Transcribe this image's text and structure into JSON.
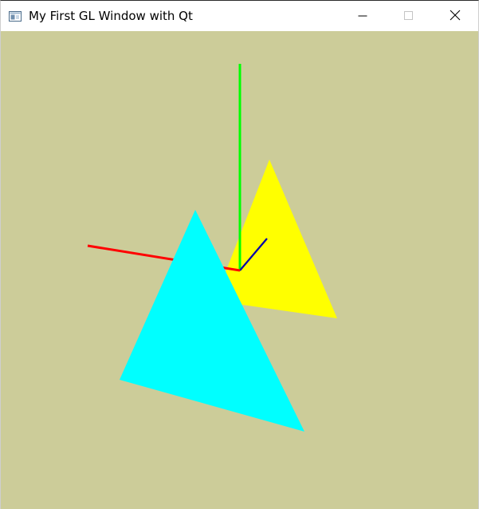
{
  "window": {
    "title": "My First GL Window with Qt",
    "controls": {
      "minimize_icon": "minimize-icon",
      "maximize_icon": "maximize-icon",
      "close_icon": "close-icon"
    }
  },
  "scene": {
    "background_color": "#cccc99",
    "triangles": [
      {
        "name": "yellow-triangle",
        "color": "#ffff00"
      },
      {
        "name": "cyan-triangle",
        "color": "#00ffff"
      }
    ],
    "axes": [
      {
        "name": "x-axis",
        "color": "#ff0000"
      },
      {
        "name": "y-axis",
        "color": "#00ff00"
      },
      {
        "name": "z-axis",
        "color": "#0000aa"
      }
    ]
  }
}
